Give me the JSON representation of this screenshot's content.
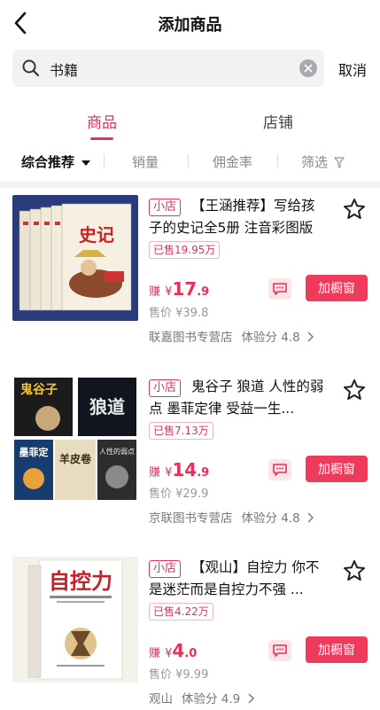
{
  "header": {
    "title": "添加商品"
  },
  "search": {
    "value": "书籍",
    "cancel_label": "取消"
  },
  "tabs": [
    {
      "label": "商品",
      "active": true
    },
    {
      "label": "店铺",
      "active": false
    }
  ],
  "filters": [
    {
      "label": "综合推荐",
      "active": true
    },
    {
      "label": "销量"
    },
    {
      "label": "佣金率"
    },
    {
      "label": "筛选"
    }
  ],
  "products": [
    {
      "shop_tag": "小店",
      "title": "【王涵推荐】写给孩子的史记全5册 注音彩图版",
      "sold": "已售19.95万",
      "earn_label": "赚",
      "currency": "¥",
      "earn_int": "17",
      "earn_dec": ".9",
      "price": "售价 ¥39.8",
      "add_label": "加橱窗",
      "store": "联嘉图书专营店",
      "experience": "体验分 4.8",
      "thumb_text": "史记"
    },
    {
      "shop_tag": "小店",
      "title": "鬼谷子 狼道 人性的弱点 墨菲定律 受益一生...",
      "sold": "已售7.13万",
      "earn_label": "赚",
      "currency": "¥",
      "earn_int": "14",
      "earn_dec": ".9",
      "price": "售价 ¥29.9",
      "add_label": "加橱窗",
      "store": "京联图书专营店",
      "experience": "体验分 4.8",
      "thumb_books": [
        "鬼谷子",
        "狼道",
        "墨菲定",
        "羊皮卷",
        "人性的弱点"
      ]
    },
    {
      "shop_tag": "小店",
      "title": "【观山】自控力 你不是迷茫而是自控力不强 ...",
      "sold": "已售4.22万",
      "earn_label": "赚",
      "currency": "¥",
      "earn_int": "4",
      "earn_dec": ".0",
      "price": "售价 ¥9.99",
      "add_label": "加橱窗",
      "store": "观山",
      "experience": "体验分 4.9",
      "thumb_text": "自控力"
    }
  ]
}
